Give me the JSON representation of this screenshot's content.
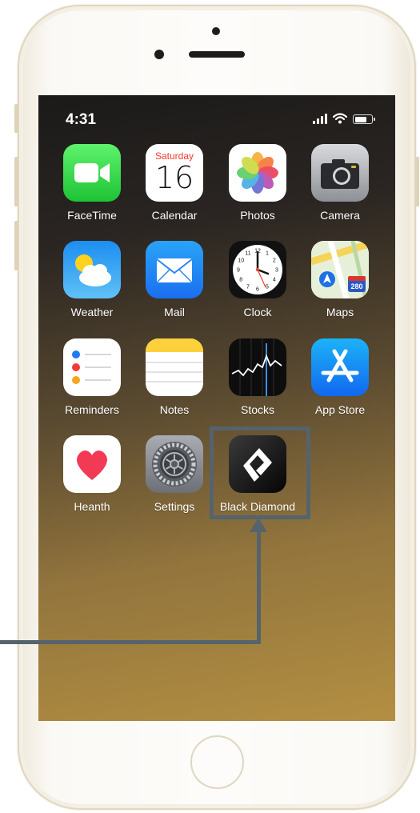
{
  "status_bar": {
    "time": "4:31",
    "battery_level": 0.7
  },
  "apps": [
    {
      "label": "FaceTime",
      "icon": "facetime-icon"
    },
    {
      "label": "Calendar",
      "icon": "calendar-icon",
      "weekday": "Saturday",
      "day": "16"
    },
    {
      "label": "Photos",
      "icon": "photos-icon"
    },
    {
      "label": "Camera",
      "icon": "camera-icon"
    },
    {
      "label": "Weather",
      "icon": "weather-icon"
    },
    {
      "label": "Mail",
      "icon": "mail-icon"
    },
    {
      "label": "Clock",
      "icon": "clock-icon",
      "numerals": [
        "12",
        "1",
        "2",
        "3",
        "4",
        "5",
        "6",
        "7",
        "8",
        "9",
        "10",
        "11"
      ]
    },
    {
      "label": "Maps",
      "icon": "maps-icon",
      "shield": "280"
    },
    {
      "label": "Reminders",
      "icon": "reminders-icon"
    },
    {
      "label": "Notes",
      "icon": "notes-icon"
    },
    {
      "label": "Stocks",
      "icon": "stocks-icon"
    },
    {
      "label": "App Store",
      "icon": "app-store-icon"
    },
    {
      "label": "Heanth",
      "icon": "health-icon"
    },
    {
      "label": "Settings",
      "icon": "settings-icon"
    },
    {
      "label": "Black Diamond",
      "icon": "black-diamond-icon"
    }
  ],
  "annotation": {
    "target": "Black Diamond",
    "color": "#55636c"
  },
  "colors": {
    "phone_frame": "#f7f3ea",
    "wallpaper_top": "#1b1a19",
    "wallpaper_bottom": "#b38f42"
  }
}
